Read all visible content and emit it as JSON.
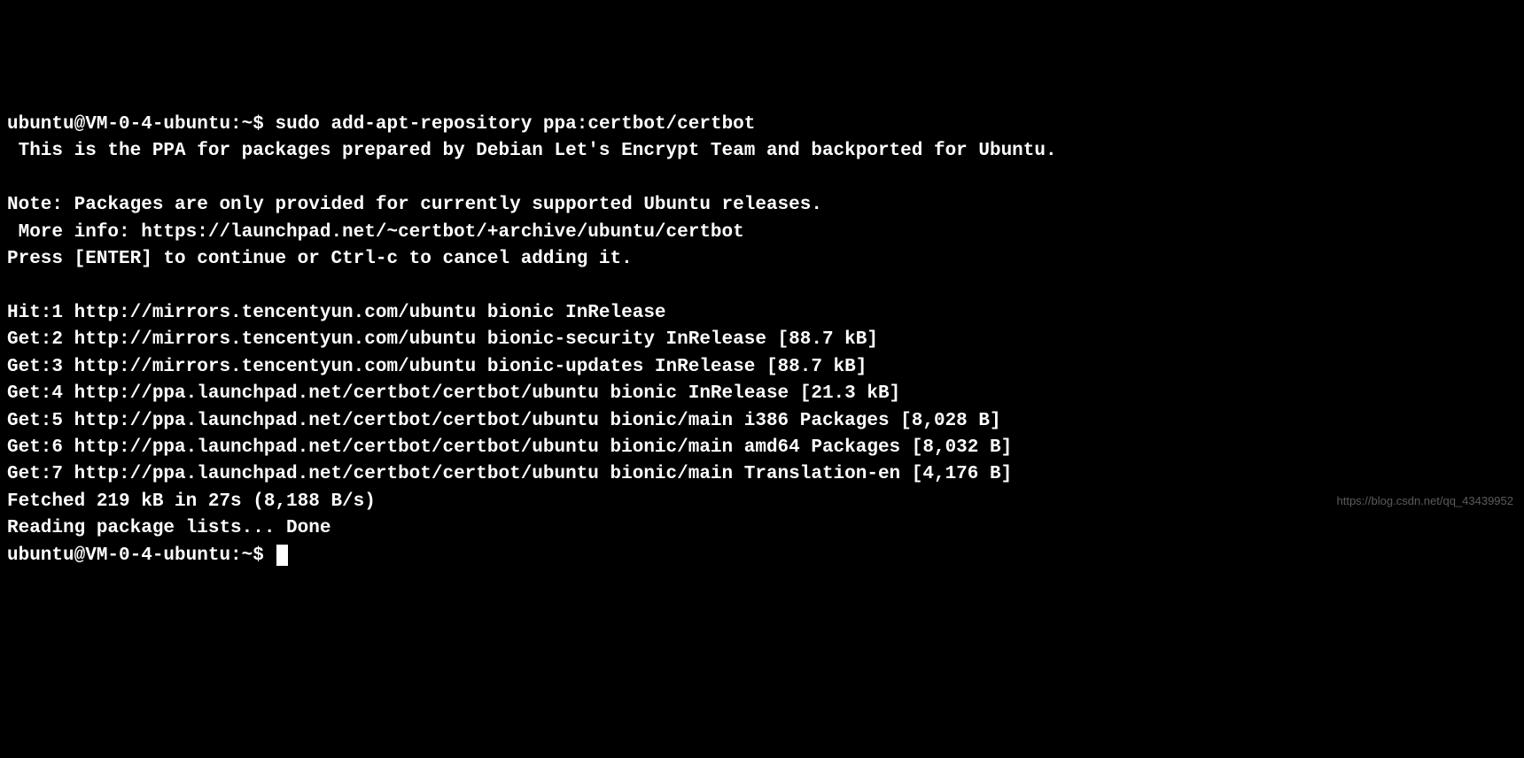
{
  "prompt1": {
    "user_host": "ubuntu@VM-0-4-ubuntu",
    "path": "~",
    "symbol": "$",
    "command": "sudo add-apt-repository ppa:certbot/certbot"
  },
  "output": {
    "desc": " This is the PPA for packages prepared by Debian Let's Encrypt Team and backported for Ubuntu.",
    "blank1": "",
    "note": "Note: Packages are only provided for currently supported Ubuntu releases.",
    "more_info": " More info: https://launchpad.net/~certbot/+archive/ubuntu/certbot",
    "press_enter": "Press [ENTER] to continue or Ctrl-c to cancel adding it.",
    "blank2": "",
    "lines": [
      "Hit:1 http://mirrors.tencentyun.com/ubuntu bionic InRelease",
      "Get:2 http://mirrors.tencentyun.com/ubuntu bionic-security InRelease [88.7 kB]",
      "Get:3 http://mirrors.tencentyun.com/ubuntu bionic-updates InRelease [88.7 kB]",
      "Get:4 http://ppa.launchpad.net/certbot/certbot/ubuntu bionic InRelease [21.3 kB]",
      "Get:5 http://ppa.launchpad.net/certbot/certbot/ubuntu bionic/main i386 Packages [8,028 B]",
      "Get:6 http://ppa.launchpad.net/certbot/certbot/ubuntu bionic/main amd64 Packages [8,032 B]",
      "Get:7 http://ppa.launchpad.net/certbot/certbot/ubuntu bionic/main Translation-en [4,176 B]",
      "Fetched 219 kB in 27s (8,188 B/s)",
      "Reading package lists... Done"
    ]
  },
  "prompt2": {
    "user_host": "ubuntu@VM-0-4-ubuntu",
    "path": "~",
    "symbol": "$"
  },
  "watermark": "https://blog.csdn.net/qq_43439952"
}
